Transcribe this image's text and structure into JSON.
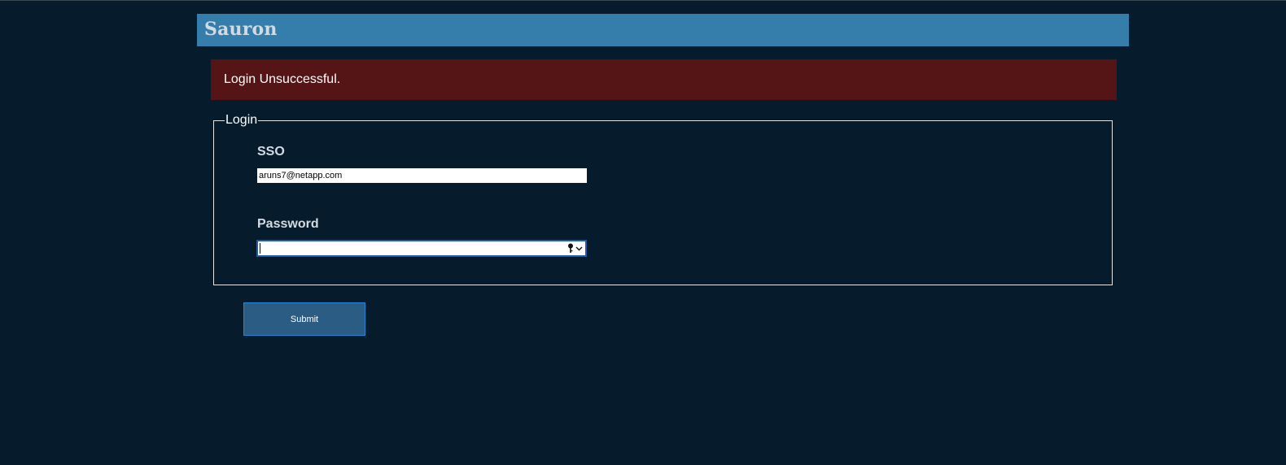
{
  "app": {
    "title": "Sauron"
  },
  "alert": {
    "message": "Login Unsuccessful.",
    "background_color": "#551416"
  },
  "login_form": {
    "legend": "Login",
    "sso": {
      "label": "SSO",
      "value": "aruns7@netapp.com"
    },
    "password": {
      "label": "Password",
      "value": "",
      "focused": true,
      "icons": [
        "key-icon",
        "chevron-down-icon"
      ]
    },
    "submit_label": "Submit"
  },
  "colors": {
    "page_background": "#061c2c",
    "header_background": "#357dab",
    "button_background": "#2b5d84",
    "button_border": "#1e88d8",
    "focus_ring": "#1f5bb5"
  }
}
